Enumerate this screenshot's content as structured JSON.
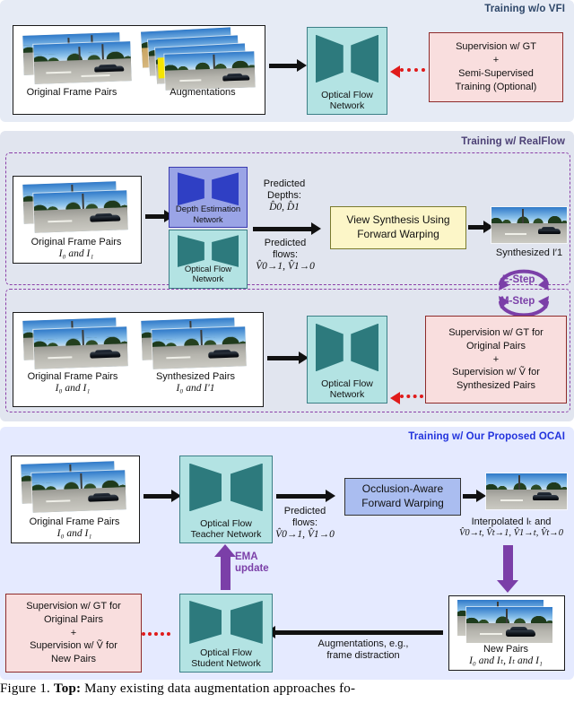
{
  "figure": {
    "caption_prefix": "Figure 1.",
    "caption_bold": "Top:",
    "caption_text": "Many existing data augmentation approaches fo-"
  },
  "panels": {
    "top": {
      "title": "Training w/o VFI",
      "title_color": "#2d4668",
      "bg_color": "#e6ebf5",
      "original_pairs_label": "Original Frame Pairs",
      "augmentations_label": "Augmentations",
      "network_label_line1": "Optical Flow",
      "network_label_line2": "Network",
      "supervision_line1": "Supervision w/ GT",
      "supervision_line2": "+",
      "supervision_line3": "Semi-Supervised",
      "supervision_line4": "Training (Optional)"
    },
    "middle": {
      "title": "Training w/ RealFlow",
      "title_color": "#4b3f74",
      "bg_color": "#e1e5ef",
      "dash_color": "#8b3fa8",
      "e_step_label": "E-Step",
      "m_step_label": "M-Step",
      "estep": {
        "original_pairs_label": "Original Frame Pairs",
        "original_pairs_sub": "I₀ and I₁",
        "depth_net_line1": "Depth Estimation",
        "depth_net_line2": "Network",
        "flow_net_line1": "Optical Flow",
        "flow_net_line2": "Network",
        "predicted_depths_label": "Predicted",
        "predicted_depths_label2": "Depths:",
        "predicted_depths_sym": "D̂0, D̂1",
        "predicted_flows_label": "Predicted",
        "predicted_flows_label2": "flows:",
        "predicted_flows_sym": "V̂0→1, V̂1→0",
        "view_synthesis_line1": "View Synthesis Using",
        "view_synthesis_line2": "Forward Warping",
        "synthesized_label": "Synthesized I′1"
      },
      "mstep": {
        "original_pairs_label": "Original Frame Pairs",
        "original_pairs_sub": "I₀ and I₁",
        "synthesized_pairs_label": "Synthesized Pairs",
        "synthesized_pairs_sub": "I₀ and I′1",
        "network_label_line1": "Optical Flow",
        "network_label_line2": "Network",
        "supervision_line1": "Supervision w/ GT for",
        "supervision_line2": "Original Pairs",
        "supervision_line3": "+",
        "supervision_line4": "Supervision w/ Ṽ for",
        "supervision_line5": "Synthesized Pairs"
      }
    },
    "bottom": {
      "title": "Training w/ Our Proposed OCAI",
      "title_color": "#2233dd",
      "bg_color": "#e5eaff",
      "original_pairs_label": "Original Frame Pairs",
      "original_pairs_sub": "I₀ and I₁",
      "teacher_line1": "Optical Flow",
      "teacher_line2": "Teacher Network",
      "predicted_flows_label": "Predicted",
      "predicted_flows_label2": "flows:",
      "predicted_flows_sym": "V̂0→1, V̂1→0",
      "occlusion_line1": "Occlusion-Aware",
      "occlusion_line2": "Forward Warping",
      "interpolated_label": "Interpolated Iₜ and",
      "interpolated_sym": "V̂0→t, V̂t→1, V̂1→t, V̂t→0",
      "new_pairs_label": "New Pairs",
      "new_pairs_sub": "I₀ and Iₜ, Iₜ and I₁",
      "augmentations_line1": "Augmentations, e.g.,",
      "augmentations_line2": "frame distraction",
      "student_line1": "Optical Flow",
      "student_line2": "Student Network",
      "supervision_line1": "Supervision w/ GT for",
      "supervision_line2": "Original Pairs",
      "supervision_line3": "+",
      "supervision_line4": "Supervision w/ Ṽ for",
      "supervision_line5": "New Pairs",
      "ema_label_line1": "EMA",
      "ema_label_line2": "update"
    }
  },
  "colors": {
    "flow_net_fill": "#b3e3e3",
    "flow_net_glass": "#2d7a7d",
    "depth_net_fill": "#9aa4e6",
    "depth_net_glass": "#2f3fc4",
    "supervision_fill": "#f9dede",
    "view_synthesis_fill": "#fcf6c8",
    "occlusion_fill": "#aabdf0",
    "ema_purple": "#7b3fa8",
    "dotted_arrow_red": "#e01b1b"
  }
}
